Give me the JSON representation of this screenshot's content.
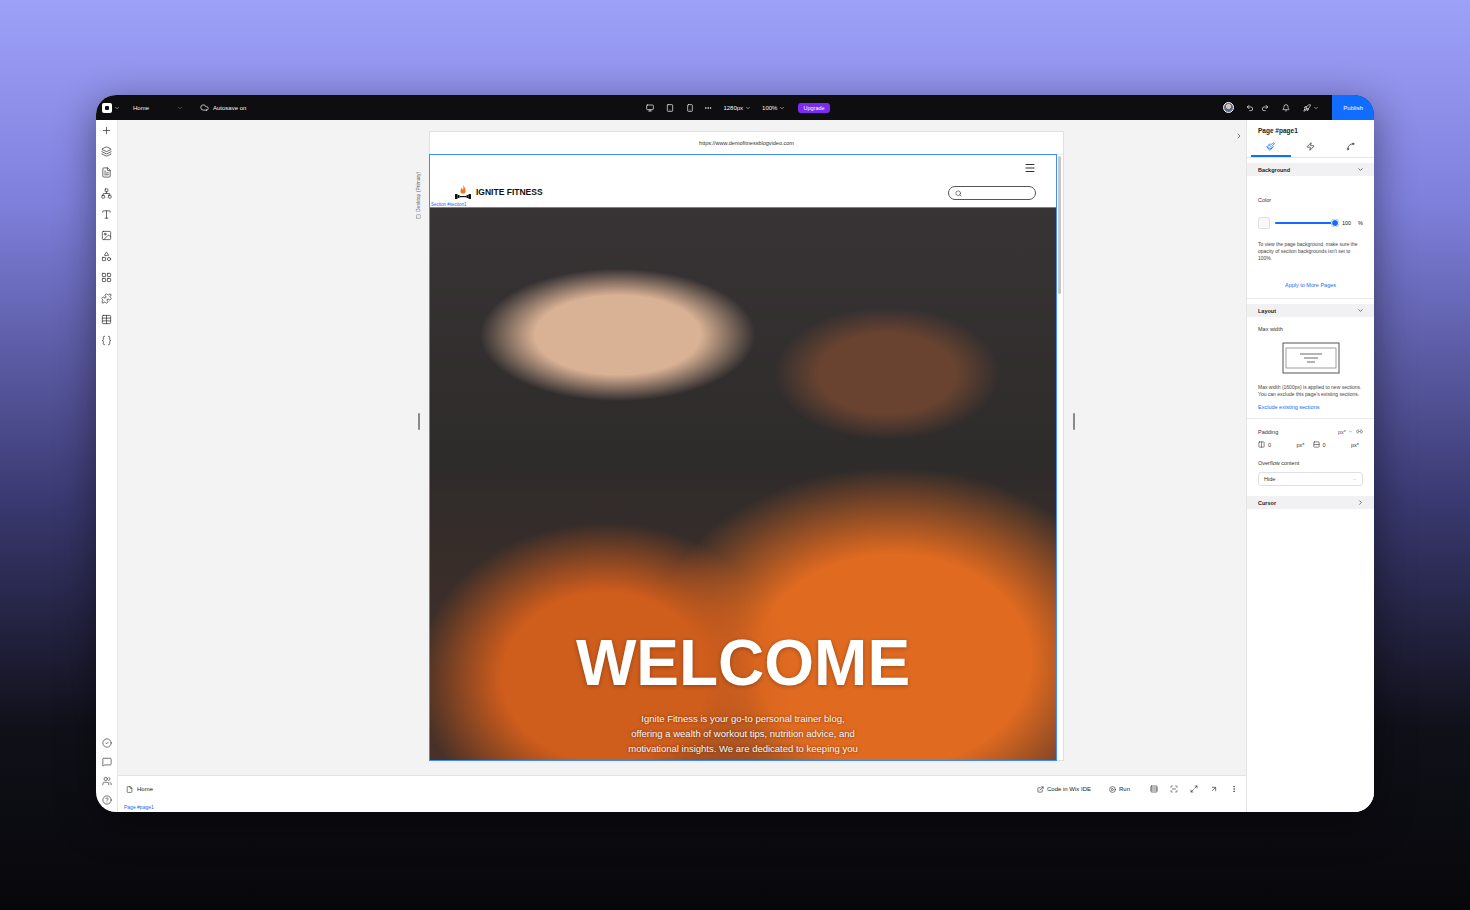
{
  "top_bar": {
    "page_menu": "Home",
    "autosave": "Autosave on",
    "canvas_width": "1280px",
    "zoom": "100%",
    "upgrade": "Upgrade",
    "publish": "Publish"
  },
  "canvas": {
    "breakpoint": "Desktop (Primary)",
    "url": "https://www.demofitnessblogvideo.com",
    "section_label": "Section #section1",
    "site": {
      "brand": "IGNITE FITNESS",
      "hero_title": "WELCOME",
      "hero_text": [
        "Ignite Fitness is your go-to personal trainer blog,",
        "offering a wealth of workout tips, nutrition advice, and",
        "motivational insights. We are dedicated to keeping you"
      ]
    }
  },
  "inspector": {
    "title": "Page #page1",
    "tabs": [
      {
        "selected": true
      },
      {
        "selected": false
      },
      {
        "selected": false
      }
    ],
    "background": {
      "heading": "Background",
      "expanded": true,
      "color_label": "Color",
      "opacity": {
        "level": 1,
        "value": "100",
        "unit": "%"
      },
      "hint": "To view the page background, make sure the opacity of section backgrounds isn't set to 100%.",
      "apply_link": "Apply to More Pages"
    },
    "layout": {
      "heading": "Layout",
      "expanded": true,
      "max_width_label": "Max width",
      "max_width_hint": "Max width (1600px) is applied to new sections. You can exclude this page's existing sections.",
      "exclude_link": "Exclude existing sections",
      "padding_label": "Padding",
      "padding_unit": "px*",
      "padding": [
        {
          "value": "0",
          "unit": "px*"
        },
        {
          "value": "0",
          "unit": "px*"
        }
      ],
      "overflow_label": "Overflow content",
      "overflow_value": "Hide"
    },
    "cursor": {
      "heading": "Cursor",
      "expanded": false
    }
  },
  "bottom_bar": {
    "page_tab": "Home",
    "code_button": "Code in Wix IDE",
    "run_button": "Run"
  },
  "footer": {
    "breadcrumb": "Page #page1"
  }
}
